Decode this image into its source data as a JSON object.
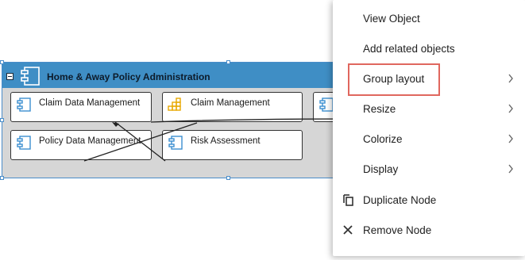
{
  "group": {
    "title": "Home & Away Policy Administration"
  },
  "nodes": [
    {
      "label": "Claim Data Management",
      "icon": "component-icon"
    },
    {
      "label": "Claim Management",
      "icon": "grid-icon"
    },
    {
      "label": "Policy Data Management",
      "icon": "component-icon"
    },
    {
      "label": "Risk Assessment",
      "icon": "component-icon"
    }
  ],
  "menu": {
    "items": [
      {
        "label": "View Object"
      },
      {
        "label": "Add related objects"
      },
      {
        "label": "Group layout",
        "submenu": true,
        "highlighted": true
      },
      {
        "label": "Resize",
        "submenu": true
      },
      {
        "label": "Colorize",
        "submenu": true
      },
      {
        "label": "Display",
        "submenu": true
      },
      {
        "label": "Duplicate Node",
        "icon": "duplicate-icon"
      },
      {
        "label": "Remove Node",
        "icon": "close-icon"
      }
    ]
  },
  "colors": {
    "header": "#3f8ec5",
    "group_bg": "#d6d6d6",
    "highlight": "#e0675e",
    "grid_icon": "#e8a800",
    "component_icon": "#3b8fd0"
  }
}
